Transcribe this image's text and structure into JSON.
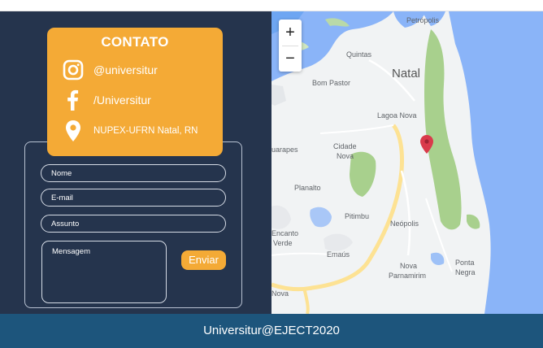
{
  "contact": {
    "title": "CONTATO",
    "instagram": "@universitur",
    "facebook": "/Universitur",
    "location": "NUPEX-UFRN Natal, RN"
  },
  "form": {
    "name_placeholder": "Nome",
    "email_placeholder": "E-mail",
    "subject_placeholder": "Assunto",
    "message_placeholder": "Mensagem",
    "send_label": "Enviar"
  },
  "map": {
    "zoom_in": "+",
    "zoom_out": "−",
    "labels": {
      "petropolis": "Petrópolis",
      "quintas": "Quintas",
      "natal": "Natal",
      "bom_pastor": "Bom Pastor",
      "lagoa_nova": "Lagoa Nova",
      "guarapes": "uarapes",
      "cidade": "Cidade",
      "nova": "Nova",
      "planalto": "Planalto",
      "pitimbu": "Pitimbu",
      "neopolis": "Neópolis",
      "encanto": "Encanto",
      "verde": "Verde",
      "emaus": "Emaús",
      "ponta": "Ponta",
      "negra": "Negra",
      "nova2": "Nova",
      "parnamirim": "Parnamirim",
      "nova3": "Nova"
    }
  },
  "footer": {
    "text": "Universitur@EJECT2020"
  },
  "colors": {
    "panel": "#25344d",
    "accent": "#f4aa36",
    "footer": "#1d557c",
    "pin": "#d93a4b"
  }
}
